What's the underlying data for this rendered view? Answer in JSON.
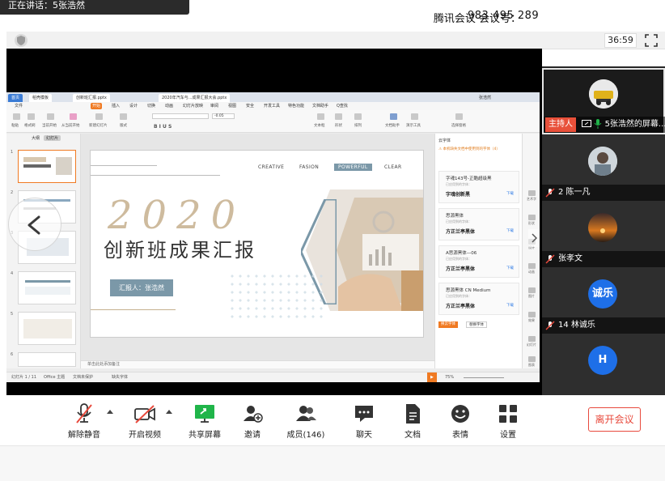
{
  "speaker": {
    "text": "正在讲话：5张浩然"
  },
  "header": {
    "app_title": "腾讯会议 会议号：",
    "meeting_id": "983 495 289",
    "timer": "36:59"
  },
  "wps": {
    "tabs": [
      {
        "label": "首页"
      },
      {
        "label": "稻壳模板"
      },
      {
        "label": "创新班汇报.pptx"
      },
      {
        "label": "2020年汽车与...成果汇报大会.pptx"
      }
    ],
    "user": "张浩然",
    "menus": [
      "文件",
      "开始",
      "插入",
      "设计",
      "切换",
      "动画",
      "幻灯片放映",
      "审阅",
      "视图",
      "安全",
      "开发工具",
      "特色功能",
      "文档助手",
      "Q查找"
    ],
    "ribbon": [
      {
        "label": "粘贴"
      },
      {
        "label": "格式刷"
      },
      {
        "label": "当前开始"
      },
      {
        "label": "从当前开始"
      },
      {
        "label": "新建幻灯片"
      },
      {
        "label": "版式"
      },
      {
        "label": "文本框"
      },
      {
        "label": "形状"
      },
      {
        "label": "排列"
      },
      {
        "label": "文档助手"
      },
      {
        "label": "演示工具"
      },
      {
        "label": "选择窗格"
      }
    ],
    "font_size": "-0.05",
    "thumb_tabs": [
      {
        "label": "大纲"
      },
      {
        "label": "幻灯片"
      }
    ],
    "thumbs": [
      {
        "num": "1"
      },
      {
        "num": "2"
      },
      {
        "num": "3"
      },
      {
        "num": "4"
      },
      {
        "num": "5"
      },
      {
        "num": "6"
      }
    ],
    "slide": {
      "nav": [
        "CREATIVE",
        "FASION",
        "POWERFUL",
        "CLEAR"
      ],
      "year": "2020",
      "title": "创新班成果汇报",
      "reporter": "汇报人：张浩然"
    },
    "notes": "单击此处添加备注",
    "font_panel": {
      "title": "云字体",
      "warning": "⚠ 本机缺失文档中使用到的字体（4）",
      "fonts": [
        {
          "name": "字魂143号-正酷超级黑",
          "sub": "已应用到的字体：",
          "sample": "字魂创新黑",
          "action": "下载"
        },
        {
          "name": "思源黑体",
          "sub": "已应用到的字体：",
          "sample": "方正兰亭黑体",
          "action": "下载"
        },
        {
          "name": "A思源黑体—06",
          "sub": "已应用到的字体：",
          "sample": "方正兰亭黑体",
          "action": "下载"
        },
        {
          "name": "思源黑体 CN Medium",
          "sub": "已应用到的字体：",
          "sample": "方正兰亭黑体",
          "action": "下载"
        }
      ],
      "btn_primary": "换云字体",
      "btn_secondary": "替换字体"
    },
    "right_tools": [
      "艺术字",
      "形状",
      "设计",
      "动画",
      "图片",
      "效果",
      "幻灯片",
      "图表"
    ],
    "status": {
      "slide_count": "幻灯片 1 / 11",
      "theme": "Office 主题",
      "protect": "文档未保护",
      "smart": "缺失字体",
      "zoom": "75%"
    }
  },
  "participants": [
    {
      "name": "5张浩然的屏幕...",
      "host_badge": "主持人",
      "kind": "image"
    },
    {
      "name": "2 陈一凡",
      "kind": "image"
    },
    {
      "name": "张孝文",
      "kind": "image"
    },
    {
      "name": "14 林诚乐",
      "kind": "text",
      "avatar_text": "诚乐"
    },
    {
      "name": "",
      "kind": "text",
      "avatar_text": "H"
    }
  ],
  "bottombar": {
    "mute": "解除静音",
    "video": "开启视频",
    "share": "共享屏幕",
    "invite": "邀请",
    "members": "成员(146)",
    "chat": "聊天",
    "docs": "文档",
    "reactions": "表情",
    "settings": "设置",
    "leave": "离开会议"
  },
  "colors": {
    "leave_red": "#e84a3d",
    "share_green": "#20b54a",
    "host_badge": "#e8503a",
    "wps_orange": "#f07a22",
    "avatar_blue": "#1e6fe8"
  }
}
